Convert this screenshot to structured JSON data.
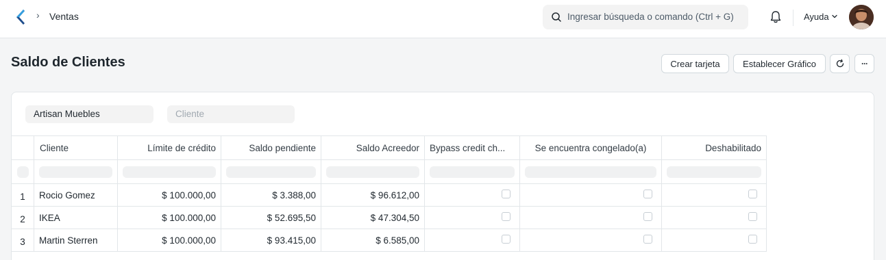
{
  "navbar": {
    "breadcrumb_sep": "›",
    "breadcrumb": "Ventas",
    "search_placeholder": "Ingresar búsqueda o comando (Ctrl + G)",
    "help_label": "Ayuda"
  },
  "page": {
    "title": "Saldo de Clientes",
    "buttons": {
      "create_card": "Crear tarjeta",
      "set_chart": "Establecer Gráfico",
      "more": "···"
    }
  },
  "filters": {
    "company": "Artisan Muebles",
    "customer_placeholder": "Cliente"
  },
  "table": {
    "columns": [
      "Cliente",
      "Límite de crédito",
      "Saldo pendiente",
      "Saldo Acreedor",
      "Bypass credit ch...",
      "Se encuentra congelado(a)",
      "Deshabilitado"
    ],
    "rows": [
      {
        "index": "1",
        "customer": "Rocio Gomez",
        "credit_limit": "$ 100.000,00",
        "outstanding": "$ 3.388,00",
        "credit_balance": "$ 96.612,00",
        "bypass": false,
        "frozen": false,
        "disabled": false
      },
      {
        "index": "2",
        "customer": "IKEA",
        "credit_limit": "$ 100.000,00",
        "outstanding": "$ 52.695,50",
        "credit_balance": "$ 47.304,50",
        "bypass": false,
        "frozen": false,
        "disabled": false
      },
      {
        "index": "3",
        "customer": "Martin Sterren",
        "credit_limit": "$ 100.000,00",
        "outstanding": "$ 93.415,00",
        "credit_balance": "$ 6.585,00",
        "bypass": false,
        "frozen": false,
        "disabled": false
      }
    ]
  },
  "colors": {
    "accent": "#1a73e8",
    "logo_dark": "#1f4e8c",
    "logo_light": "#36a0e0"
  }
}
